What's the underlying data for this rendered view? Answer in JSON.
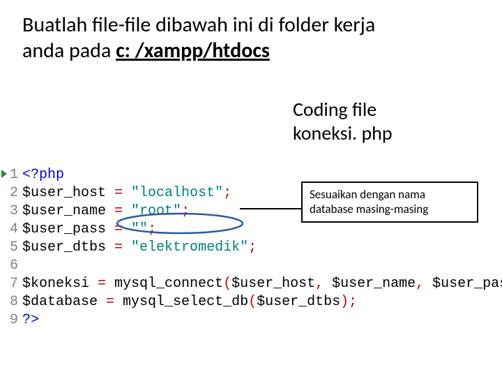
{
  "heading": {
    "line1": "Buatlah file-file dibawah ini di folder kerja",
    "line2_prefix": "anda pada ",
    "line2_bold": "c: /xampp/htdocs"
  },
  "subtitle": {
    "line1": "Coding file",
    "line2": "koneksi. php"
  },
  "note": {
    "line1": "Sesuaikan dengan nama",
    "line2": "database masing-masing"
  },
  "code": {
    "open_tag": "<?php",
    "vars": {
      "user_host": "$user_host",
      "user_name": "$user_name",
      "user_pass": "$user_pass",
      "user_dtbs": "$user_dtbs",
      "koneksi": "$koneksi",
      "database": "$database"
    },
    "vals": {
      "localhost": "\"localhost\"",
      "root": "\"root\"",
      "empty": "\"\"",
      "db": "\"elektromedik\""
    },
    "fn": {
      "connect": "mysql_connect",
      "select": "mysql_select_db"
    },
    "close_tag": "?>",
    "eq": " = ",
    "semi": ";",
    "comma": ", ",
    "lp": "(",
    "rp": ")"
  },
  "linenos": [
    "1",
    "2",
    "3",
    "4",
    "5",
    "6",
    "7",
    "8",
    "9"
  ]
}
